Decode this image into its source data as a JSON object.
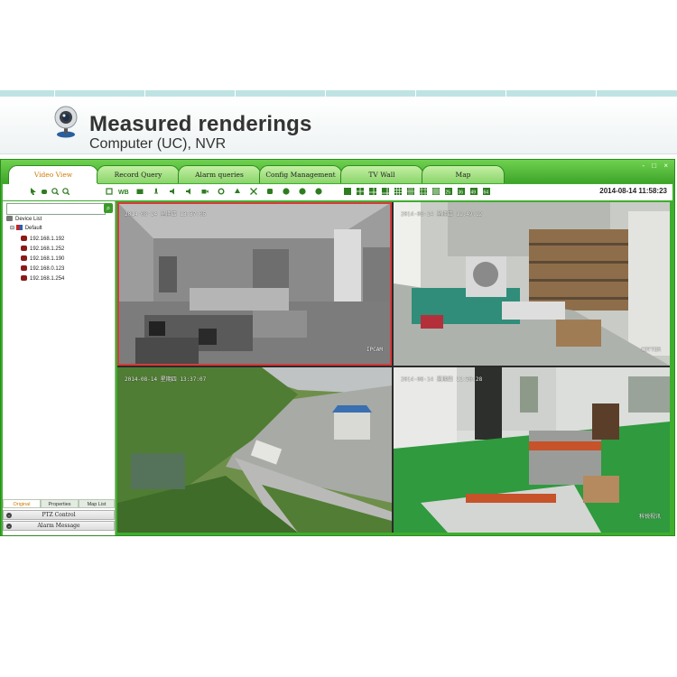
{
  "banner": {
    "title": "Measured renderings",
    "subtitle": "Computer (UC), NVR",
    "icon": "webcam-icon"
  },
  "app": {
    "tabs": [
      {
        "label": "Video View",
        "active": true
      },
      {
        "label": "Record Query",
        "active": false
      },
      {
        "label": "Alarm queries",
        "active": false
      },
      {
        "label": "Config Management",
        "active": false
      },
      {
        "label": "TV Wall",
        "active": false
      },
      {
        "label": "Map",
        "active": false
      }
    ],
    "window_controls": "- □ ×",
    "datetime": "2014-08-14 11:58:23",
    "accent_color": "#3fae2e",
    "selected_border_color": "#d83a3a"
  },
  "sidebar": {
    "search_placeholder": "",
    "search_button_icon": "search-icon",
    "root_label": "Device List",
    "group_label": "Default",
    "devices": [
      "192.168.1.192",
      "192.168.1.252",
      "192.168.1.190",
      "192.168.0.123",
      "192.168.1.254"
    ],
    "bottom_tabs": [
      {
        "label": "Original",
        "active": true
      },
      {
        "label": "Properties",
        "active": false
      },
      {
        "label": "Map List",
        "active": false
      }
    ],
    "ptz_label": "PTZ Control",
    "alarm_label": "Alarm Message"
  },
  "video": {
    "cells": [
      {
        "timestamp": "2014-08-14 星期四 13:37:05",
        "caption": "IPCAM",
        "selected": true,
        "scene": "office-night"
      },
      {
        "timestamp": "2014-08-14 星期四 11:49:12",
        "caption": "COTTER",
        "selected": false,
        "scene": "warehouse"
      },
      {
        "timestamp": "2014-08-14 星期四 13:37:07",
        "caption": "",
        "selected": false,
        "scene": "outdoor-hillside"
      },
      {
        "timestamp": "2014-08-14 星期四 11:50:28",
        "caption": "科锐视讯",
        "selected": false,
        "scene": "office-green-floor"
      }
    ]
  }
}
